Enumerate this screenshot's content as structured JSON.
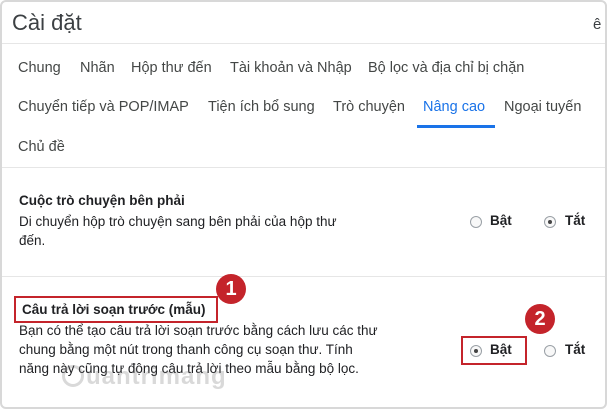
{
  "header": {
    "title": "Cài đặt",
    "title_tail": "ê"
  },
  "tabs_row1": [
    "Chung",
    "Nhãn",
    "Hộp thư đến",
    "Tài khoản và Nhập",
    "Bộ lọc và địa chỉ bị chặn"
  ],
  "tabs_row2": [
    "Chuyển tiếp và POP/IMAP",
    "Tiện ích bổ sung",
    "Trò chuyện",
    "Nâng cao",
    "Ngoại tuyến"
  ],
  "tabs_row3": [
    "Chủ đề"
  ],
  "active_tab": "Nâng cao",
  "setting_chat": {
    "title": "Cuộc trò chuyện bên phải",
    "desc": "Di chuyển hộp trò chuyện sang bên phải của hộp thư đến.",
    "on_label": "Bật",
    "off_label": "Tắt",
    "selected": "off"
  },
  "setting_canned": {
    "title": "Câu trả lời soạn trước (mẫu)",
    "desc": "Bạn có thể tạo câu trả lời soạn trước bằng cách lưu các thư chung bằng một nút trong thanh công cụ soạn thư. Tính năng này cũng tự động câu trả lời theo mẫu bằng bộ lọc.",
    "on_label": "Bật",
    "off_label": "Tắt",
    "selected": "on"
  },
  "markers": {
    "m1": "1",
    "m2": "2"
  },
  "watermark": "uantrimang",
  "colors": {
    "accent": "#1a73e8",
    "annotation": "#c4242b"
  }
}
